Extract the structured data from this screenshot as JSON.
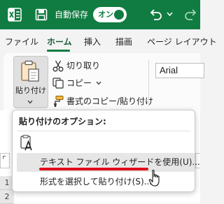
{
  "titlebar": {
    "autosave_label": "自動保存",
    "autosave_toggle": "オン",
    "accent_color": "#107c41",
    "icons": [
      "excel-logo-icon",
      "save-icon",
      "undo-icon",
      "chevron-down-icon",
      "redo-icon"
    ]
  },
  "tabs": [
    {
      "label": "ファイル"
    },
    {
      "label": "ホーム",
      "active": true
    },
    {
      "label": "挿入"
    },
    {
      "label": "描画"
    },
    {
      "label": "ページ レイアウト"
    }
  ],
  "ribbon": {
    "paste_label": "貼り付け",
    "cut_label": "切り取り",
    "copy_label": "コピー",
    "format_painter_label": "書式のコピー/貼り付け",
    "font_name": "Arial"
  },
  "paste_menu": {
    "heading": "貼り付けのオプション:",
    "items": [
      {
        "label": "テキスト ファイル ウィザードを使用(U)..."
      },
      {
        "label": "形式を選択して貼り付け(S)..."
      }
    ],
    "annotation_color": "#e10d1c"
  },
  "sheet": {
    "row_numbers": [
      "1",
      "2"
    ]
  }
}
